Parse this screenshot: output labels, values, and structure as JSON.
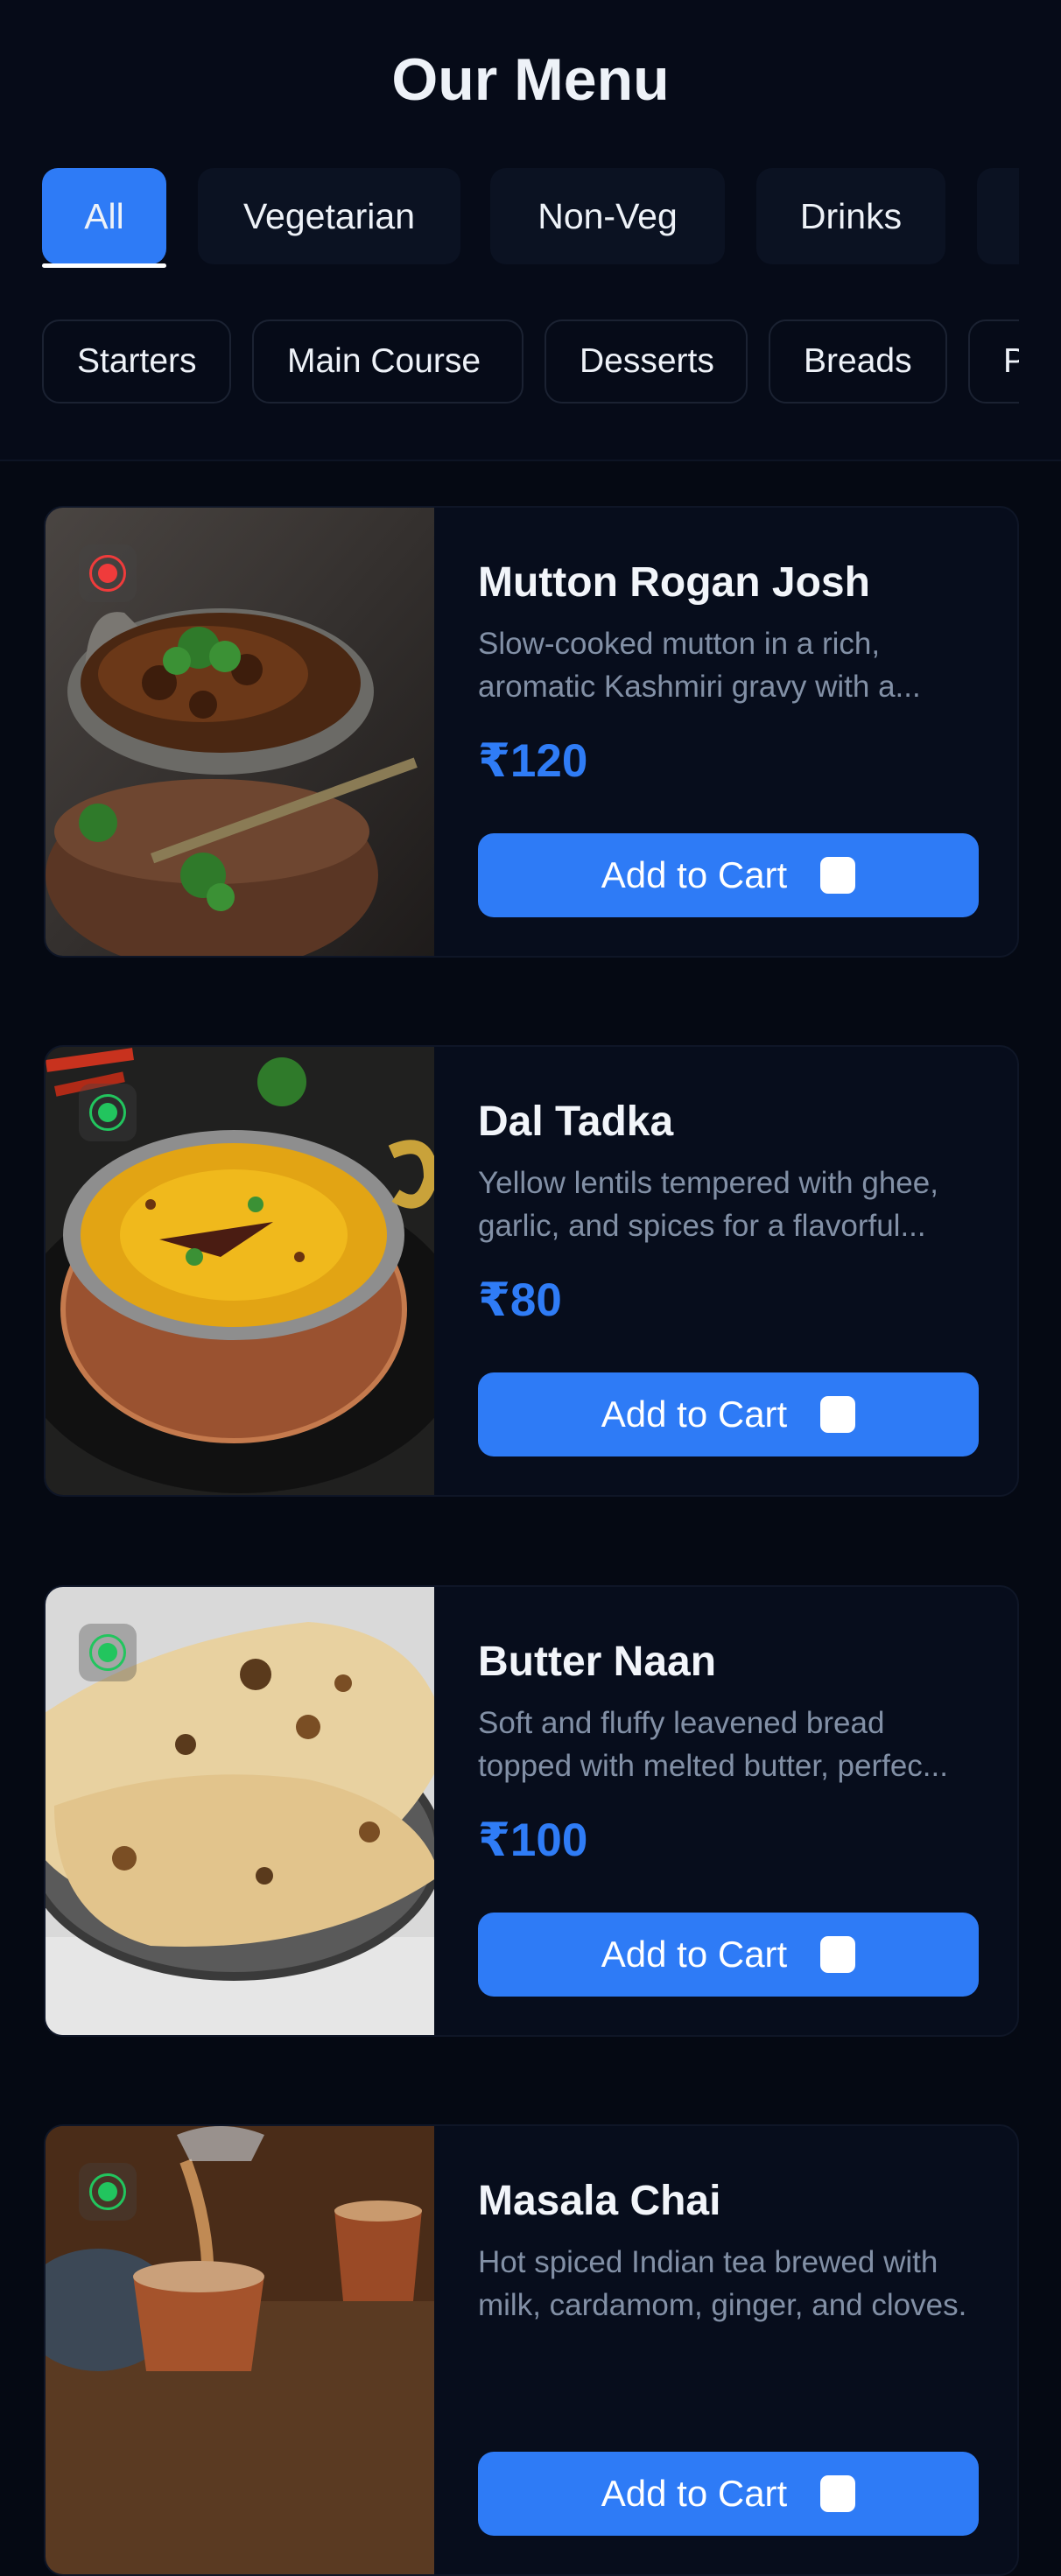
{
  "header": {
    "title": "Our Menu",
    "type_filters": [
      "All",
      "Vegetarian",
      "Non-Veg",
      "Drinks"
    ],
    "active_filter": "All",
    "category_filters": [
      "Starters",
      "Main Course",
      "Desserts",
      "Breads",
      "P"
    ]
  },
  "menu": [
    {
      "name": "Mutton Rogan Josh",
      "desc_line1": "Slow-cooked mutton in a rich,",
      "desc_line2": "aromatic Kashmiri gravy with a...",
      "price": "₹120",
      "diet": "non-veg",
      "button": "Add to Cart"
    },
    {
      "name": "Dal Tadka",
      "desc_line1": "Yellow lentils tempered with ghee,",
      "desc_line2": "garlic, and spices for a flavorful...",
      "price": "₹80",
      "diet": "veg",
      "button": "Add to Cart"
    },
    {
      "name": "Butter Naan",
      "desc_line1": "Soft and fluffy leavened bread",
      "desc_line2": "topped with melted butter, perfec...",
      "price": "₹100",
      "diet": "veg",
      "button": "Add to Cart"
    },
    {
      "name": "Masala Chai",
      "desc_line1": "Hot spiced Indian tea brewed with",
      "desc_line2": "milk, cardamom, ginger, and cloves.",
      "price": "",
      "diet": "veg",
      "button": "Add to Cart"
    }
  ],
  "colors": {
    "accent": "#2e7bf6",
    "veg": "#22c55e",
    "non_veg": "#ef3b3b",
    "background": "#050913"
  },
  "icons": {
    "cart_button": "shopping-bag-icon",
    "diet_marker": "diet-indicator-icon"
  }
}
